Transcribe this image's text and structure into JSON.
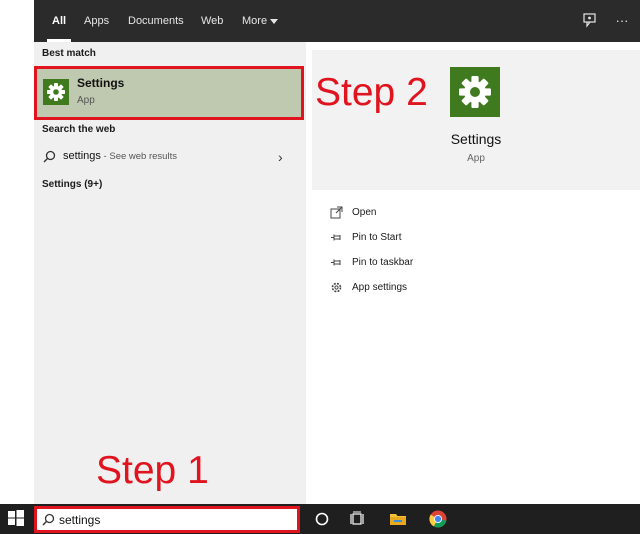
{
  "tabs": [
    {
      "label": "All",
      "active": true
    },
    {
      "label": "Apps",
      "active": false
    },
    {
      "label": "Documents",
      "active": false
    },
    {
      "label": "Web",
      "active": false
    },
    {
      "label": "More",
      "active": false
    }
  ],
  "top_icons": [
    "feedback-icon",
    "more-options-icon"
  ],
  "results": {
    "best_match_label": "Best match",
    "best_match": {
      "title": "Settings",
      "subtitle": "App",
      "icon": "gear-icon"
    },
    "search_web_label": "Search the web",
    "web_result": {
      "query": "settings",
      "suffix": " - See web results",
      "icon": "search-icon"
    },
    "settings_group_label": "Settings (9+)"
  },
  "preview": {
    "title": "Settings",
    "subtitle": "App",
    "icon": "gear-icon",
    "actions": [
      {
        "label": "Open",
        "icon": "open-icon"
      },
      {
        "label": "Pin to Start",
        "icon": "pin-icon"
      },
      {
        "label": "Pin to taskbar",
        "icon": "pin-icon"
      },
      {
        "label": "App settings",
        "icon": "gear-icon"
      }
    ]
  },
  "annotations": {
    "step1": "Step 1",
    "step2": "Step 2"
  },
  "taskbar": {
    "search_value": "settings",
    "icons": [
      "windows-start-icon",
      "search-icon",
      "cortana-icon",
      "task-view-icon",
      "file-explorer-icon",
      "chrome-icon"
    ]
  },
  "colors": {
    "accent_red": "#e0141e",
    "tile_green": "#3f7a1f",
    "selection_green": "#bfc9b0",
    "topbar": "#2b2b2b",
    "taskbar": "#1f1f1f"
  }
}
